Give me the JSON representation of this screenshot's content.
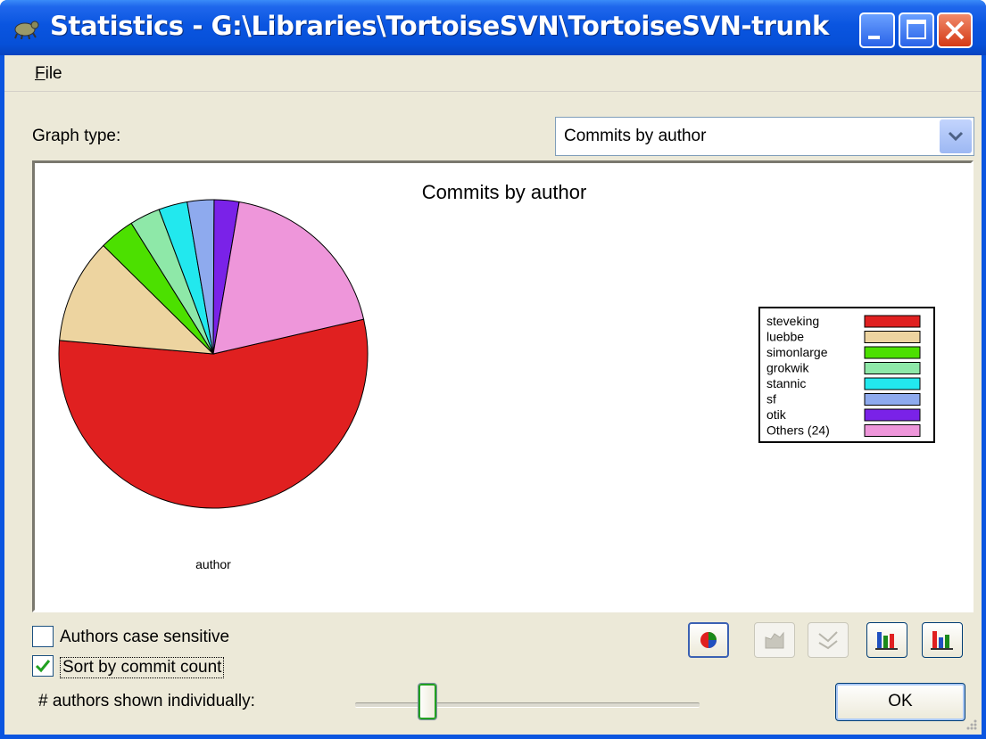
{
  "window": {
    "title": "Statistics - G:\\Libraries\\TortoiseSVN\\TortoiseSVN-trunk",
    "icon": "tortoise-icon"
  },
  "menu": {
    "file": "File"
  },
  "graph_type": {
    "label": "Graph type:",
    "selected": "Commits by author"
  },
  "chart_data": {
    "type": "pie",
    "title": "Commits by author",
    "xlabel": "author",
    "categories": [
      "steveking",
      "luebbe",
      "simonlarge",
      "grokwik",
      "stannic",
      "sf",
      "otik",
      "Others (24)"
    ],
    "values": [
      55,
      11,
      3.7,
      3.2,
      3.0,
      2.8,
      2.6,
      18.7
    ],
    "colors": [
      "#e02020",
      "#edd4a0",
      "#4ce000",
      "#8ee8a8",
      "#22e8ee",
      "#8eaaee",
      "#7a22e8",
      "#ee96da"
    ],
    "legend": "right"
  },
  "options": {
    "authors_case_sensitive": {
      "label": "Authors case sensitive",
      "checked": false
    },
    "sort_by_commit_count": {
      "label": "Sort by commit count",
      "checked": true
    }
  },
  "graph_buttons": [
    {
      "name": "pie",
      "enabled": true,
      "pressed": true
    },
    {
      "name": "line",
      "enabled": false
    },
    {
      "name": "area",
      "enabled": false
    },
    {
      "name": "stacked-bar",
      "enabled": true
    },
    {
      "name": "bar",
      "enabled": true
    }
  ],
  "authors_shown": {
    "label": "# authors shown individually:",
    "slider_fraction": 0.2
  },
  "ok_button": "OK"
}
